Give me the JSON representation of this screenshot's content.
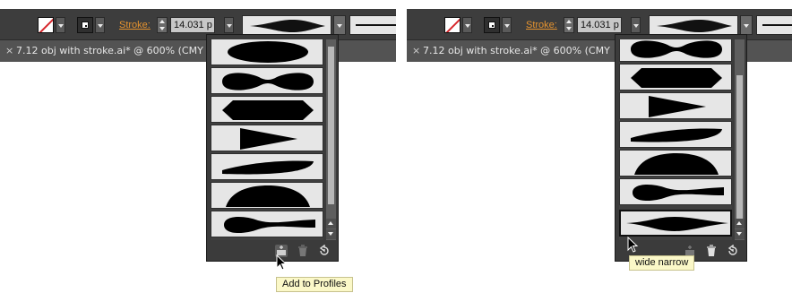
{
  "left_panel": {
    "stroke_label": "Stroke:",
    "stroke_weight": "14.031 p",
    "document_tab_title": "7.12 obj with stroke.ai* @ 600% (CMY",
    "close_glyph": "×",
    "profiles": [
      "width-profile-1",
      "width-profile-2",
      "width-profile-3",
      "width-profile-4",
      "width-profile-5",
      "width-profile-6",
      "width-profile-7"
    ],
    "footer_icons": [
      "add-to-profiles-icon",
      "trash-icon",
      "reset-icon"
    ],
    "tooltip": "Add to Profiles"
  },
  "right_panel": {
    "stroke_label": "Stroke:",
    "stroke_weight": "14.031 p",
    "document_tab_title": "7.12 obj with stroke.ai* @ 600% (CMY",
    "close_glyph": "×",
    "profiles": [
      "width-profile-2",
      "width-profile-3",
      "width-profile-4",
      "width-profile-5",
      "width-profile-6",
      "width-profile-7",
      "width-profile-8"
    ],
    "selected_profile_index": 6,
    "footer_icons": [
      "add-to-profiles-icon",
      "trash-icon",
      "reset-icon"
    ],
    "tooltip": "wide narrow"
  },
  "colors": {
    "panel_bg": "#3d3d3d",
    "stroke_label": "#e5932f",
    "tooltip_bg": "#fbf8c8",
    "profile_bg": "#e6e6e6"
  }
}
